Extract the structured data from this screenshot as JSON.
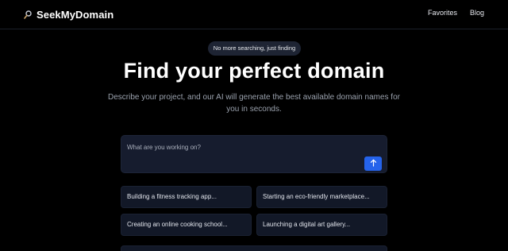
{
  "header": {
    "brand_name": "SeekMyDomain",
    "brand_icon": "magnifier-icon",
    "nav": {
      "favorites_label": "Favorites",
      "blog_label": "Blog"
    }
  },
  "hero": {
    "tagline": "No more searching, just finding",
    "title": "Find your perfect domain",
    "subtitle": "Describe your project, and our AI will generate the best available domain names for you in seconds."
  },
  "prompt": {
    "placeholder": "What are you working on?",
    "value": "",
    "submit_icon": "arrow-up-icon",
    "submit_color": "#2563eb"
  },
  "suggestions": [
    "Building a fitness tracking app...",
    "Starting an eco-friendly marketplace...",
    "Creating an online cooking school...",
    "Launching a digital art gallery..."
  ],
  "colors": {
    "background": "#000000",
    "card": "#121827",
    "input": "#161c2e",
    "accent": "#2563eb"
  }
}
